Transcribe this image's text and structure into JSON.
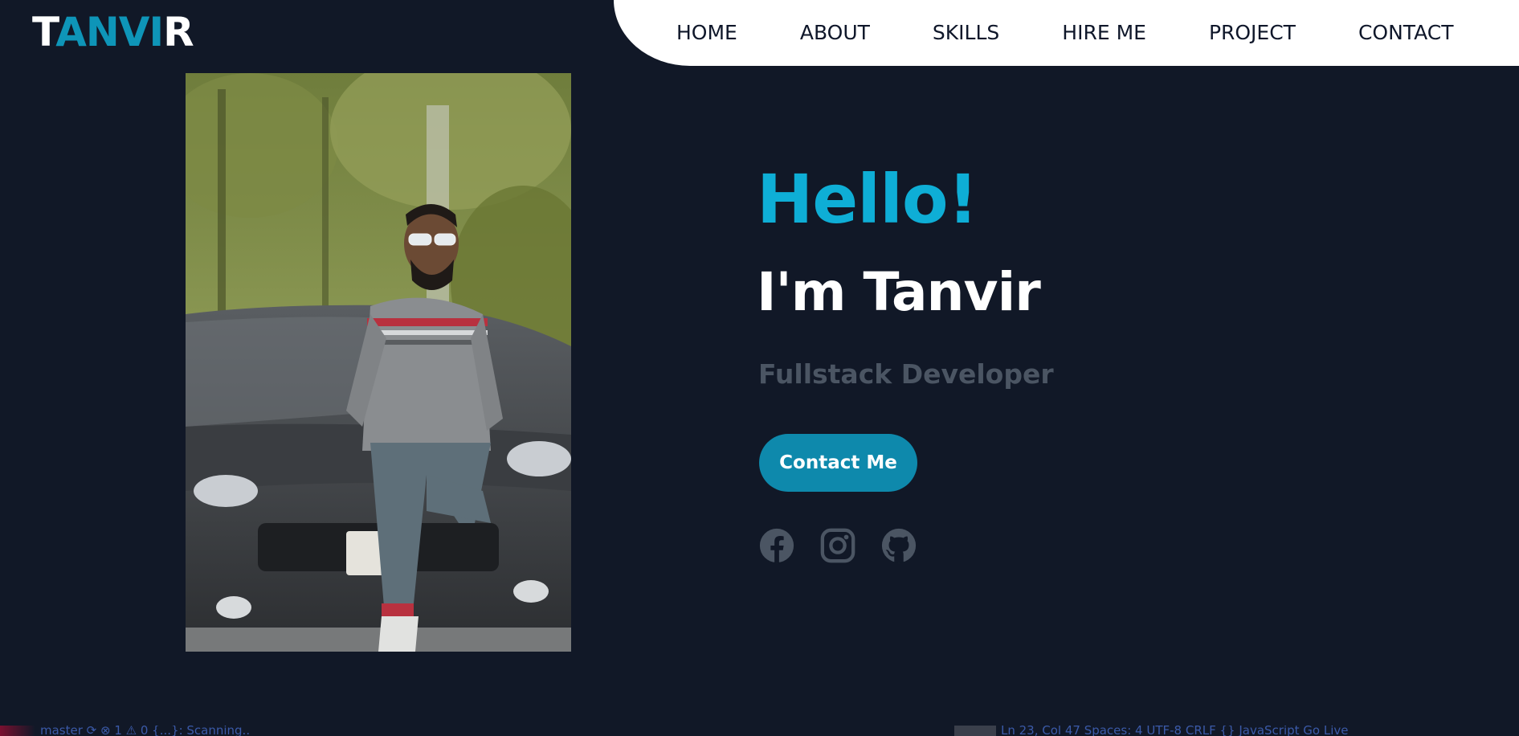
{
  "header": {
    "logo": {
      "first": "T",
      "middle": "ANVI",
      "last": "R"
    },
    "nav": [
      {
        "label": "HOME"
      },
      {
        "label": "ABOUT"
      },
      {
        "label": "SKILLS"
      },
      {
        "label": "HIRE ME"
      },
      {
        "label": "PROJECT"
      },
      {
        "label": "CONTACT"
      }
    ]
  },
  "hero": {
    "greeting": "Hello!",
    "name": "I'm Tanvir",
    "role": "Fullstack Developer",
    "cta_label": "Contact Me",
    "photo_name": "profile-photo",
    "socials": [
      {
        "icon": "facebook-icon"
      },
      {
        "icon": "instagram-icon"
      },
      {
        "icon": "github-icon"
      }
    ]
  },
  "status_bar": {
    "left": "master   ⟳   ⊗ 1 ⚠ 0   {...}: Scanning..",
    "right": "Ln 23, Col 47    Spaces: 4    UTF-8    CRLF    {} JavaScript    Go Live"
  },
  "colors": {
    "background": "#111827",
    "accent": "#0eaed6",
    "button": "#0e89ac",
    "nav_bg": "#ffffff",
    "muted": "#4b5563"
  }
}
